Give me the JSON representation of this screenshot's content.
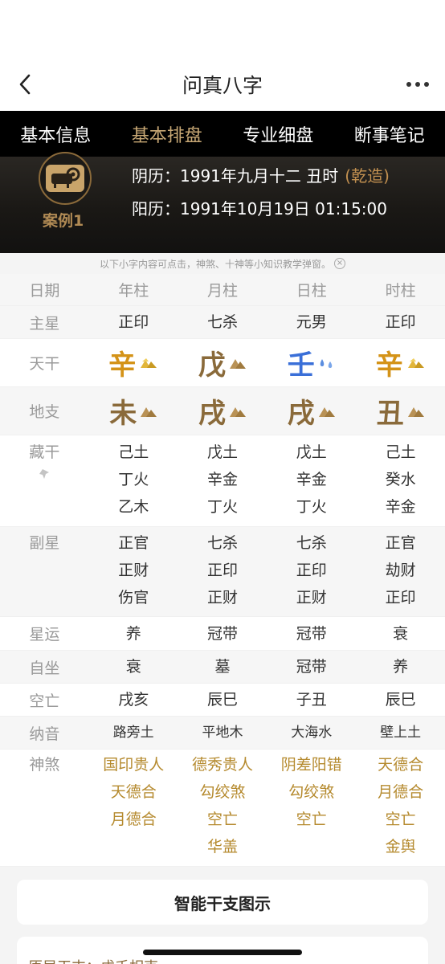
{
  "nav": {
    "title": "问真八字"
  },
  "tabs": [
    "基本信息",
    "基本排盘",
    "专业细盘",
    "断事笔记"
  ],
  "active_tab": 1,
  "header": {
    "case_label": "案例1",
    "lunar": "阴历：1991年九月十二 丑时",
    "gender": "(乾造)",
    "solar": "阳历：1991年10月19日 01:15:00"
  },
  "notice": "以下小字内容可点击，神煞、十神等小知识教学弹窗。",
  "table": {
    "headers": [
      "日期",
      "年柱",
      "月柱",
      "日柱",
      "时柱"
    ],
    "main_star": {
      "label": "主星",
      "values": [
        "正印",
        "七杀",
        "元男",
        "正印"
      ]
    },
    "tiangan": {
      "label": "天干",
      "values": [
        "辛",
        "戊",
        "壬",
        "辛"
      ]
    },
    "dizhi": {
      "label": "地支",
      "values": [
        "未",
        "戌",
        "戌",
        "丑"
      ]
    },
    "canggan": {
      "label": "藏干",
      "columns": [
        [
          "己土",
          "丁火",
          "乙木"
        ],
        [
          "戊土",
          "辛金",
          "丁火"
        ],
        [
          "戊土",
          "辛金",
          "丁火"
        ],
        [
          "己土",
          "癸水",
          "辛金"
        ]
      ]
    },
    "fuxing": {
      "label": "副星",
      "columns": [
        [
          "正官",
          "正财",
          "伤官"
        ],
        [
          "七杀",
          "正印",
          "正财"
        ],
        [
          "七杀",
          "正印",
          "正财"
        ],
        [
          "正官",
          "劫财",
          "正印"
        ]
      ]
    },
    "xingyun": {
      "label": "星运",
      "values": [
        "养",
        "冠带",
        "冠带",
        "衰"
      ]
    },
    "zizuo": {
      "label": "自坐",
      "values": [
        "衰",
        "墓",
        "冠带",
        "养"
      ]
    },
    "kongwang": {
      "label": "空亡",
      "values": [
        "戌亥",
        "辰巳",
        "子丑",
        "辰巳"
      ]
    },
    "nayin": {
      "label": "纳音",
      "values": [
        "路旁土",
        "平地木",
        "大海水",
        "壁上土"
      ]
    },
    "shensha": {
      "label": "神煞",
      "columns": [
        [
          "国印贵人",
          "天德合",
          "月德合"
        ],
        [
          "德秀贵人",
          "勾绞煞",
          "空亡",
          "华盖"
        ],
        [
          "阴差阳错",
          "勾绞煞",
          "空亡"
        ],
        [
          "天德合",
          "月德合",
          "空亡",
          "金舆"
        ]
      ]
    }
  },
  "button": "智能干支图示",
  "bottom_card_text": "原局干支：戊壬相克",
  "colors": {
    "tab_active": "#c8a875",
    "earth": "#8a6a3a",
    "fire": "#b8282a",
    "metal": "#d49318",
    "water": "#3a6fd8",
    "wood": "#3ea040",
    "shensha": "#b58a2e"
  }
}
